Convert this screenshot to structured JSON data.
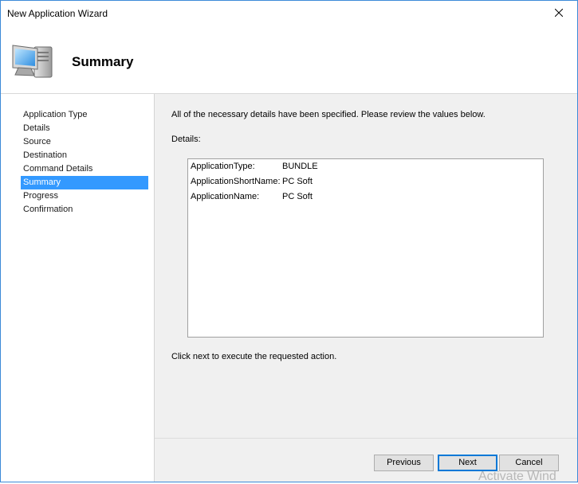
{
  "window": {
    "title": "New Application Wizard",
    "close_icon": "close-icon"
  },
  "header": {
    "title": "Summary",
    "icon": "computer-icon"
  },
  "nav": {
    "items": [
      {
        "label": "Application Type",
        "selected": false
      },
      {
        "label": "Details",
        "selected": false
      },
      {
        "label": "Source",
        "selected": false
      },
      {
        "label": "Destination",
        "selected": false
      },
      {
        "label": "Command Details",
        "selected": false
      },
      {
        "label": "Summary",
        "selected": true
      },
      {
        "label": "Progress",
        "selected": false
      },
      {
        "label": "Confirmation",
        "selected": false
      }
    ]
  },
  "content": {
    "intro": "All of the necessary details have been specified.  Please review the values below.",
    "details_label": "Details:",
    "details": [
      {
        "key": "ApplicationType:",
        "value": "BUNDLE"
      },
      {
        "key": "ApplicationShortName:",
        "value": "PC Soft"
      },
      {
        "key": "ApplicationName:",
        "value": "PC Soft"
      }
    ],
    "footer_note": "Click next to execute the requested action."
  },
  "buttons": {
    "previous": "Previous",
    "next": "Next",
    "cancel": "Cancel"
  },
  "watermark": "Activate Wind",
  "colors": {
    "selection": "#3399ff",
    "window_border": "#3c8ad8",
    "default_button_border": "#0078d7"
  }
}
